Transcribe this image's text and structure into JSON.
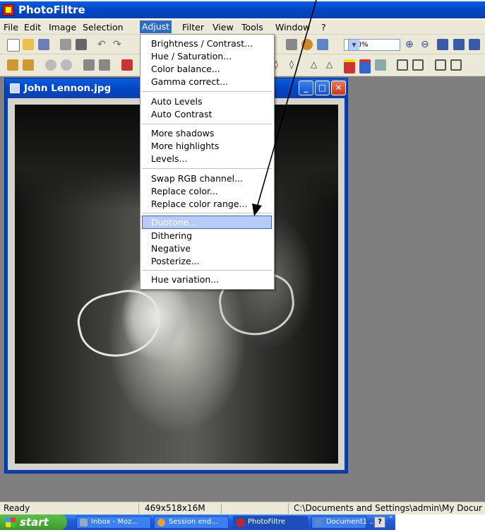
{
  "app": {
    "title": "PhotoFiltre"
  },
  "menubar": [
    "File",
    "Edit",
    "Image",
    "Selection",
    "Adjust",
    "Filter",
    "View",
    "Tools",
    "Window",
    "?"
  ],
  "toolbar": {
    "zoom": "100%"
  },
  "image_window": {
    "title": "John Lennon.jpg"
  },
  "adjust_menu": {
    "items": [
      "Brightness / Contrast...",
      "Hue / Saturation...",
      "Color balance...",
      "Gamma correct...",
      "Auto Levels",
      "Auto Contrast",
      "More shadows",
      "More highlights",
      "Levels...",
      "Swap RGB channel...",
      "Replace color...",
      "Replace color range...",
      "Duotone...",
      "Dithering",
      "Negative",
      "Posterize...",
      "Hue variation..."
    ],
    "highlighted": "Duotone..."
  },
  "statusbar": {
    "status": "Ready",
    "dimensions": "469x518x16M",
    "path": "C:\\Documents and Settings\\admin\\My Docur"
  },
  "taskbar": {
    "start": "start",
    "tasks": [
      "Inbox - Moz...",
      "Session end...",
      "PhotoFiltre",
      "Document1 ..."
    ]
  }
}
